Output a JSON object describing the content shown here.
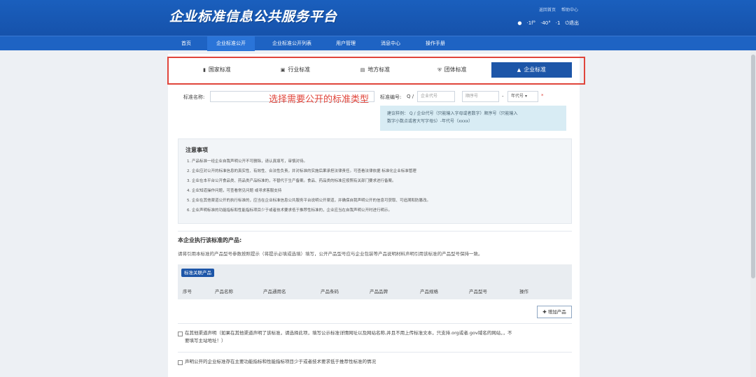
{
  "header": {
    "logo": "企业标准信息公共服务平台",
    "links": [
      "返回首页",
      "帮助中心"
    ],
    "user": {
      "name": "·1f°",
      "org": "·40°",
      "extra": "·1",
      "logout": "退出"
    }
  },
  "nav": [
    "首页",
    "企业标准公开",
    "企业标准公开列表",
    "用户管理",
    "消息中心",
    "操作手册"
  ],
  "tabs": [
    {
      "label": "国家标准",
      "icon": "book-icon"
    },
    {
      "label": "行业标准",
      "icon": "briefcase-icon"
    },
    {
      "label": "地方标准",
      "icon": "document-icon"
    },
    {
      "label": "团体标准",
      "icon": "shield-icon"
    },
    {
      "label": "企业标准",
      "icon": "bank-icon"
    }
  ],
  "form": {
    "name_label": "标准名称:",
    "number_label": "标准编号:",
    "prefix": "Q /",
    "code_placeholder": "企业代号",
    "seq_placeholder": "顺序号",
    "dash": "-",
    "year_select": "年代号",
    "required": "*"
  },
  "annotation": "选择需要公开的标准类型",
  "hint": {
    "line1": "建议样例：  Q / 企业代号（只能输入字母或者数字）顺序号（只能输入",
    "line2": "数字小数点或者大写字母S）-年代号（xxxx）"
  },
  "notice": {
    "title": "注意事项",
    "items": [
      "1. 产品标准一经企业自我声明公开不可删除，请认真填写，审慎对待。",
      "2. 企业应对公开的标准信息的真实性、有效性、合法性负责，并对标准的实施后果承担法律责任。可查看法律依据 标准化企业标准管理",
      "3. 企业在本平台公开食品类、药品类产品标准的，不替代于生产备案。食品、药品类的标准应按照有关部门要求进行备案。",
      "4. 企业知道操作问题，可查看常见问题 或寻求客服支持",
      "5. 企业在其他渠道公开的执行标准的，应当在企业标准信息公共服务平台说明公开渠道，并确保自我声明公开的信息可获取、可追溯和防篡改。",
      "6. 企业声明标准的功能指标和性能指标项目少于或者技术要求低于推荐性标准的，企业应当在自我声明公开时进行明示。"
    ]
  },
  "products": {
    "title": "本企业执行该标准的产品:",
    "desc": "请将引用本标准的产品型号参数按照提示（将提示必填或选填）填写，公开产品型号应与企业包装等产品说明材料声明引用该标准的产品型号保持一致。",
    "badge": "标准关联产品",
    "columns": [
      "序号",
      "产品名称",
      "产品通用名",
      "产品条码",
      "产品品牌",
      "产品规格",
      "产品型号",
      "操作"
    ],
    "add_button": "增加产品"
  },
  "checks": {
    "other_channel_line1": "在其他渠道声明（如果在其他渠道声明了该标准，请选择此项，填写公示标准详情网址以及网站名称,并且不用上传标准文本，只支持.org或者.gov域名的网站，，不",
    "other_channel_line2": "要填写主站地址！）",
    "declaration": "声明公开的企业标准存在主要功能指标和性能指标项目少于或者技术要求低于推荐性标准的情况"
  }
}
